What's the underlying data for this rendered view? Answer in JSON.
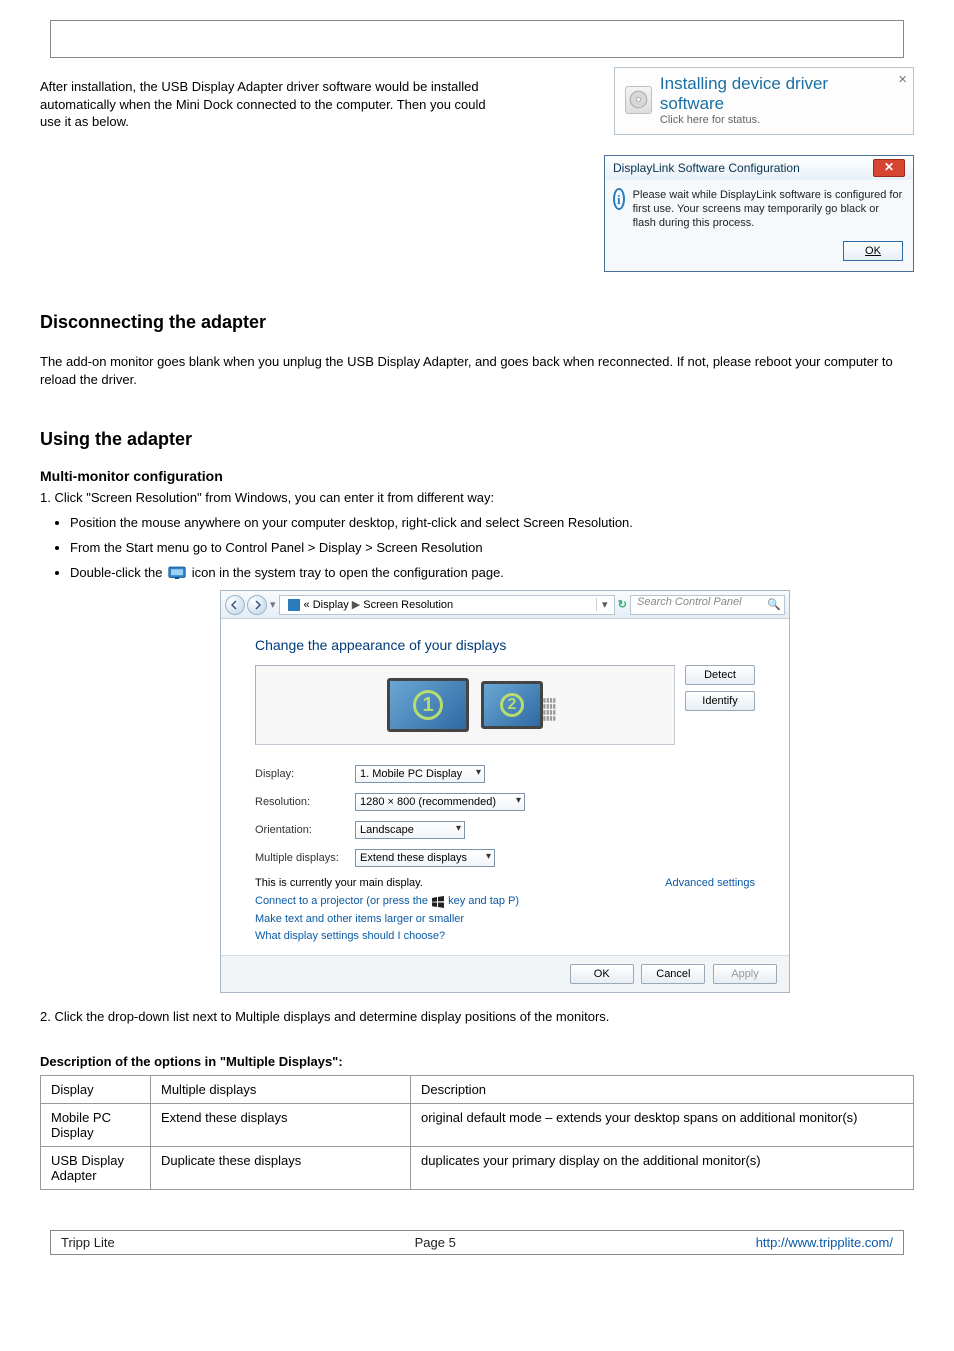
{
  "doc": {
    "para_after_install": "After installation, the USB Display Adapter driver software would be installed automatically when the Mini Dock connected to the computer. Then you could use it as below.",
    "notification": {
      "title": "Installing device driver software",
      "subtitle": "Click here for status."
    },
    "dl_config": {
      "title": "DisplayLink Software Configuration",
      "message": "Please wait while DisplayLink software is configured for first use. Your screens may temporarily go black or flash during this process.",
      "ok": "OK"
    },
    "disconnect_h": "Disconnecting the adapter",
    "disconnect_p": "The add-on monitor goes blank when you unplug the USB Display Adapter, and goes back when reconnected. If not, please reboot your computer to reload the driver.",
    "using_h": "Using the adapter",
    "multi_h": "Multi-monitor configuration",
    "multi_p1": "1. Click \"Screen Resolution\" from Windows, you can enter it from different way:",
    "multi_bullets": [
      "Position the mouse anywhere on your computer desktop, right-click and select Screen Resolution.",
      "From the Start menu go to Control Panel > Display > Screen Resolution",
      "Double-click the       icon in the system tray to open the configuration page."
    ],
    "screenres": {
      "breadcrumb_prefix": "«",
      "path1": "Display",
      "chevron": "▶",
      "path2": "Screen Resolution",
      "search_placeholder": "Search Control Panel",
      "heading": "Change the appearance of your displays",
      "btn_detect": "Detect",
      "btn_identify": "Identify",
      "label_display": "Display:",
      "val_display": "1. Mobile PC Display",
      "label_res": "Resolution:",
      "val_res": "1280 × 800 (recommended)",
      "label_orient": "Orientation:",
      "val_orient": "Landscape",
      "label_multi": "Multiple displays:",
      "val_multi": "Extend these displays",
      "main_display_text": "This is currently your main display.",
      "advanced_link": "Advanced settings",
      "link_projector": "Connect to a projector (or press the 🪟 key and tap P)",
      "link_textsize": "Make text and other items larger or smaller",
      "link_what": "What display settings should I choose?",
      "ok": "OK",
      "cancel": "Cancel",
      "apply": "Apply"
    },
    "multi_p2": "2. Click the drop-down list next to Multiple displays and determine display positions of the monitors.",
    "table_heading": "Description of the options in \"Multiple Displays\":",
    "table": {
      "h1": "Display",
      "h2": "Multiple displays",
      "h3": "Description",
      "r1c1": "Mobile PC Display",
      "r1c2": "Extend these displays",
      "r1c3": "original default mode – extends your desktop spans on additional monitor(s)",
      "r2c1": "USB Display Adapter",
      "r2c2": "Duplicate these displays",
      "r2c3": "duplicates your primary display on the additional monitor(s)"
    },
    "footer": {
      "copyright": "Tripp Lite",
      "page": "Page 5",
      "url": "http://www.tripplite.com/"
    }
  }
}
